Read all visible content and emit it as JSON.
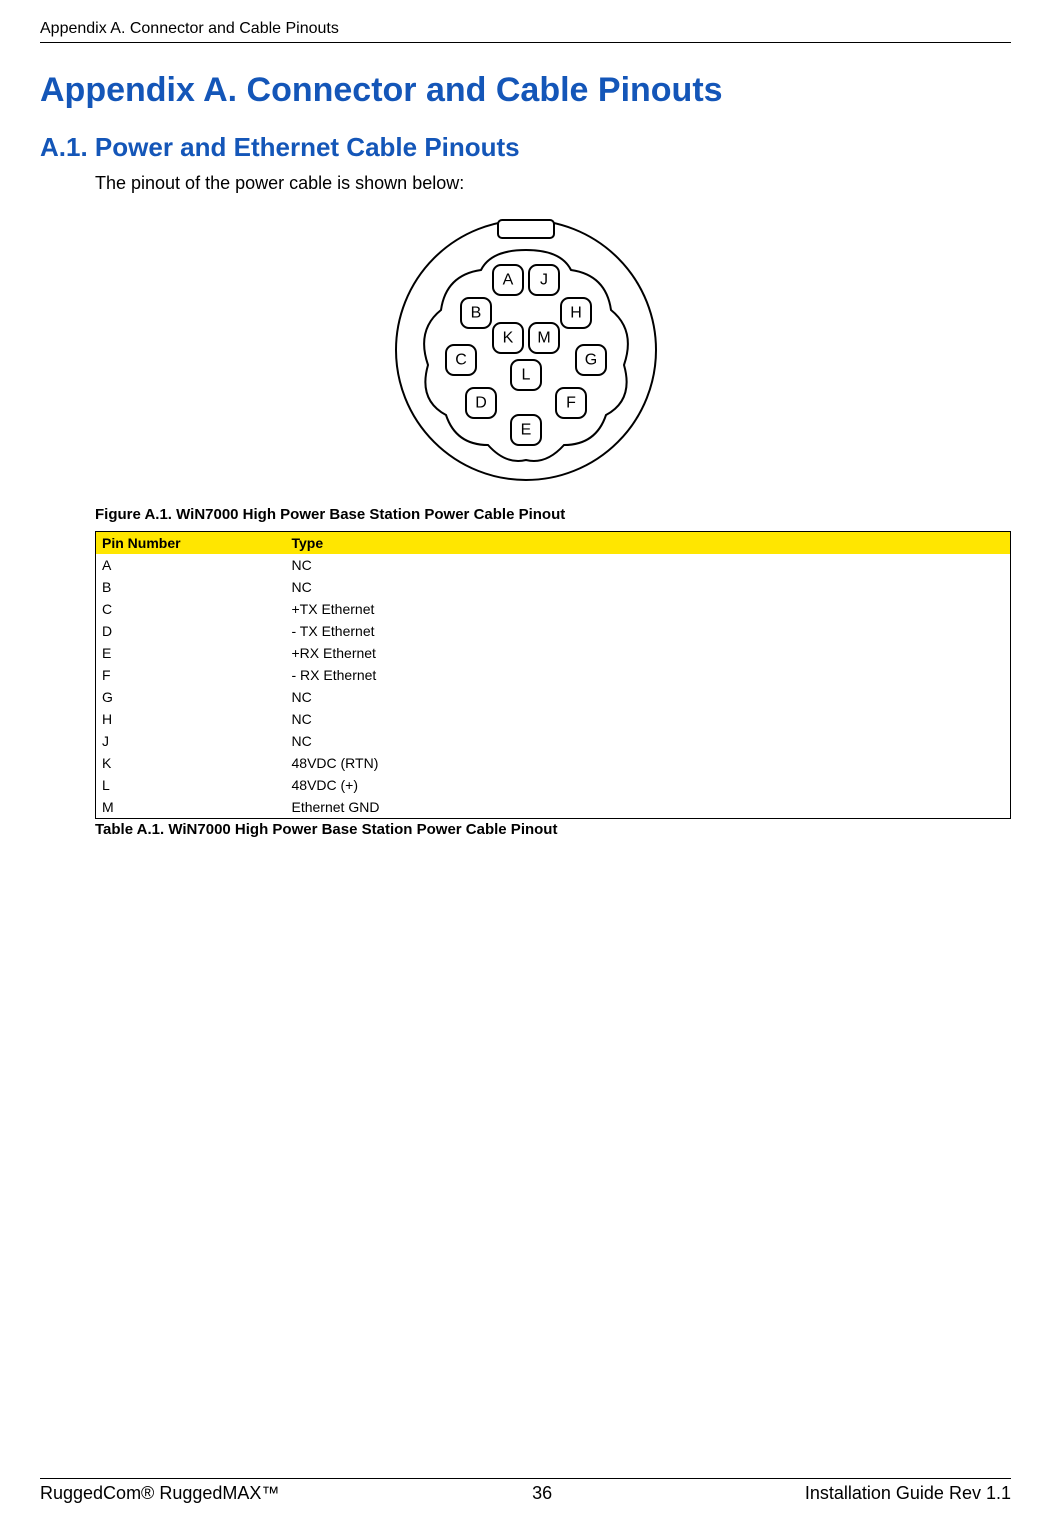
{
  "header": {
    "running_title": "Appendix A. Connector and Cable Pinouts"
  },
  "title": "Appendix A. Connector and Cable Pinouts",
  "section": {
    "number_title": "A.1. Power and Ethernet Cable Pinouts",
    "intro": "The pinout of the power cable is shown below:"
  },
  "figure": {
    "caption": "Figure A.1. WiN7000 High Power Base Station Power Cable Pinout",
    "pins": [
      "A",
      "J",
      "B",
      "H",
      "K",
      "M",
      "C",
      "G",
      "L",
      "D",
      "F",
      "E"
    ]
  },
  "table": {
    "headers": {
      "col1": "Pin Number",
      "col2": "Type"
    },
    "rows": [
      {
        "pin": "A",
        "type": "NC"
      },
      {
        "pin": "B",
        "type": "NC"
      },
      {
        "pin": "C",
        "type": "+TX Ethernet"
      },
      {
        "pin": "D",
        "type": "- TX Ethernet"
      },
      {
        "pin": "E",
        "type": "+RX Ethernet"
      },
      {
        "pin": "F",
        "type": "- RX Ethernet"
      },
      {
        "pin": "G",
        "type": "NC"
      },
      {
        "pin": "H",
        "type": "NC"
      },
      {
        "pin": "J",
        "type": "NC"
      },
      {
        "pin": "K",
        "type": "48VDC (RTN)"
      },
      {
        "pin": "L",
        "type": "48VDC (+)"
      },
      {
        "pin": "M",
        "type": "Ethernet GND"
      }
    ],
    "caption": "Table A.1. WiN7000 High Power Base Station Power Cable Pinout"
  },
  "footer": {
    "left": "RuggedCom® RuggedMAX™",
    "center": "36",
    "right": "Installation Guide Rev 1.1"
  }
}
